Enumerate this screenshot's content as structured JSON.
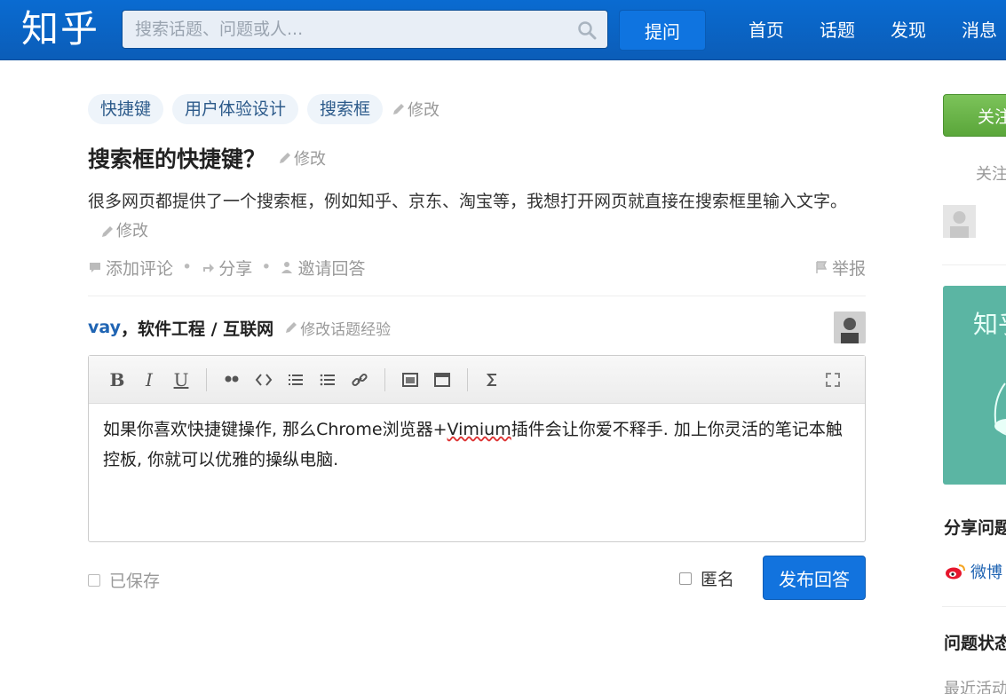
{
  "header": {
    "logo": "知乎",
    "search_placeholder": "搜索话题、问题或人...",
    "ask_label": "提问",
    "nav": [
      "首页",
      "话题",
      "发现",
      "消息"
    ]
  },
  "question": {
    "tags": [
      "快捷键",
      "用户体验设计",
      "搜索框"
    ],
    "edit_label": "修改",
    "title": "搜索框的快捷键？",
    "detail": "很多网页都提供了一个搜索框，例如知乎、京东、淘宝等，我想打开网页就直接在搜索框里输入文字。",
    "actions": {
      "comment": "添加评论",
      "share": "分享",
      "invite": "邀请回答",
      "report": "举报"
    }
  },
  "answer": {
    "author_name": "vay",
    "author_bio": "，软件工程 / 互联网",
    "edit_topic_label": "修改话题经验",
    "text_part1": "如果你喜欢快捷键操作, 那么Chrome浏览器+",
    "text_misspelled": "Vimium",
    "text_part2": "插件会让你爱不释手. 加上你灵活的笔记本触控板, 你就可以优雅的操纵电脑.",
    "saved_label": "已保存",
    "anonymous_label": "匿名",
    "publish_label": "发布回答"
  },
  "toolbar": {
    "bold": "B",
    "italic": "I",
    "underline": "U"
  },
  "sidebar": {
    "follow_label": "关注问题",
    "followers_label": "关注",
    "promo_text": "知乎",
    "share_title": "分享问题",
    "weibo_label": "微博",
    "status_title": "问题状态",
    "recent_label": "最近活动"
  },
  "colors": {
    "header_blue": "#0b5db8",
    "link_blue": "#1f64b3",
    "follow_green": "#5aa63a",
    "promo_teal": "#5bb5a3"
  }
}
